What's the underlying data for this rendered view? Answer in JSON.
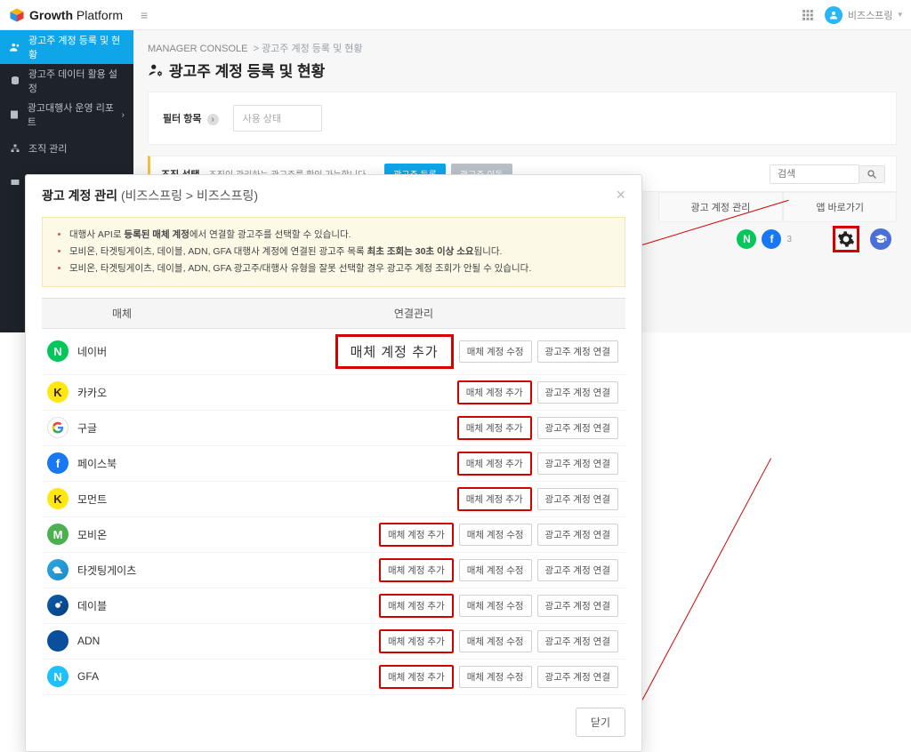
{
  "brand": {
    "name_bold": "Growth",
    "name_light": "Platform"
  },
  "user": {
    "name": "비즈스프링"
  },
  "sidebar": {
    "items": [
      {
        "label": "광고주 계정 등록 및 현황"
      },
      {
        "label": "광고주 데이터 활용 설정"
      },
      {
        "label": "광고대행사 운영 리포트"
      },
      {
        "label": "조직 관리"
      },
      {
        "label": ""
      }
    ]
  },
  "breadcrumb": {
    "root": "MANAGER CONSOLE",
    "leaf": "광고주 계정 등록 및 현황"
  },
  "page": {
    "title": "광고주 계정 등록 및 현황"
  },
  "filter": {
    "label": "필터 항목",
    "placeholder": "사용 상태"
  },
  "orgbar": {
    "label": "조직 선택",
    "note": "조직이 관리하는 광고주를 확인 가능합니다.",
    "btn_register": "광고주 등록",
    "btn_move": "광고주 이동",
    "search_placeholder": "검색"
  },
  "tabs": {
    "acct_mgmt": "광고 계정 관리",
    "app_shortcut": "앱 바로가기"
  },
  "shortcut": {
    "count": "3"
  },
  "modal": {
    "title": "광고 계정 관리",
    "sub": "(비즈스프링 > 비즈스프링)",
    "info1_a": "대행사 API로 ",
    "info1_b": "등록된 매체 계정",
    "info1_c": "에서 연결할 광고주를 선택할 수 있습니다.",
    "info2_a": "모비온, 타겟팅게이츠, 데이블, ADN, GFA 대행사 계정에 연결된 광고주 목록 ",
    "info2_b": "최초 조회는 30초 이상 소요",
    "info2_c": "됩니다.",
    "info3": "모비온, 타겟팅게이츠, 데이블, ADN, GFA 광고주/대행사 유형을 잘못 선택할 경우 광고주 계정 조회가 안될 수 있습니다.",
    "col_media": "매체",
    "col_mgmt": "연결관리",
    "btn_add": "매체 계정 추가",
    "btn_edit": "매체 계정 수정",
    "btn_link": "광고주 계정 연결",
    "btn_close": "닫기",
    "rows": [
      {
        "name": "네이버",
        "icon": "mi-naver",
        "glyph": "N",
        "big_add": true,
        "edit": true,
        "link": true
      },
      {
        "name": "카카오",
        "icon": "mi-kakao",
        "glyph": "K",
        "big_add": false,
        "edit": false,
        "link": true
      },
      {
        "name": "구글",
        "icon": "mi-google",
        "glyph": "G",
        "big_add": false,
        "edit": false,
        "link": true
      },
      {
        "name": "페이스북",
        "icon": "mi-facebook",
        "glyph": "f",
        "big_add": false,
        "edit": false,
        "link": true
      },
      {
        "name": "모먼트",
        "icon": "mi-moment",
        "glyph": "K",
        "big_add": false,
        "edit": false,
        "link": true
      },
      {
        "name": "모비온",
        "icon": "mi-mobion",
        "glyph": "M",
        "big_add": false,
        "edit": true,
        "link": true
      },
      {
        "name": "타겟팅게이츠",
        "icon": "mi-tg",
        "glyph": "",
        "big_add": false,
        "edit": true,
        "link": true
      },
      {
        "name": "데이블",
        "icon": "mi-dable",
        "glyph": "",
        "big_add": false,
        "edit": true,
        "link": true
      },
      {
        "name": "ADN",
        "icon": "mi-adn",
        "glyph": "",
        "big_add": false,
        "edit": true,
        "link": true
      },
      {
        "name": "GFA",
        "icon": "mi-gfa",
        "glyph": "N",
        "big_add": false,
        "edit": true,
        "link": true
      }
    ]
  }
}
